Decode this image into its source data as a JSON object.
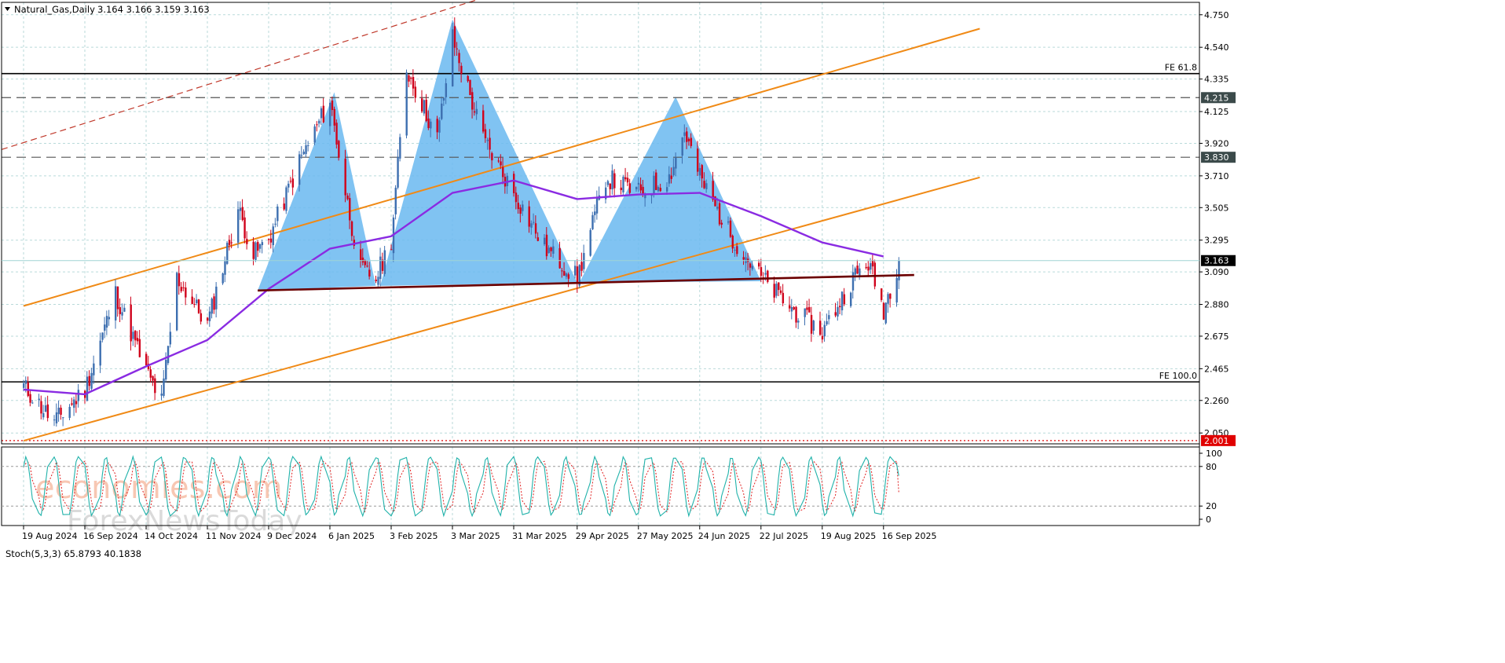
{
  "header": {
    "symbol": "Natural_Gas,Daily",
    "ohlc": "3.164 3.166 3.159 3.163"
  },
  "stoch": {
    "label": "Stoch(5,3,3) 65.8793 40.1838",
    "levels": [
      100,
      80,
      20,
      0
    ]
  },
  "watermark": {
    "line1": "economies.com",
    "line2": "ForexNewsToday"
  },
  "colors": {
    "bull_candle": "#3d6fb0",
    "bear_candle": "#d0021b",
    "pattern_fill": "#6ab8f0",
    "channel": "#f08a16",
    "moving_average": "#8a2be2",
    "neckline": "#6b0000",
    "dashed_top": "#c0392b",
    "stoch_main": "#20b2aa",
    "stoch_signal": "#e02020",
    "grid": "#b9dada"
  },
  "chart_data": {
    "type": "candlestick",
    "instrument": "Natural_Gas",
    "timeframe": "Daily",
    "last_price": 3.163,
    "ylim": [
      1.98,
      4.83
    ],
    "y_ticks": [
      "4.750",
      "4.540",
      "4.335",
      "4.125",
      "3.920",
      "3.710",
      "3.505",
      "3.295",
      "3.090",
      "2.880",
      "2.675",
      "2.465",
      "2.260",
      "2.050"
    ],
    "x_ticks": [
      "19 Aug 2024",
      "16 Sep 2024",
      "14 Oct 2024",
      "11 Nov 2024",
      "9 Dec 2024",
      "6 Jan 2025",
      "3 Feb 2025",
      "3 Mar 2025",
      "31 Mar 2025",
      "29 Apr 2025",
      "27 May 2025",
      "24 Jun 2025",
      "22 Jul 2025",
      "19 Aug 2025",
      "16 Sep 2025"
    ],
    "horizontal_levels": [
      {
        "label": "FE 61.8",
        "value": 4.37,
        "style": "solid"
      },
      {
        "label": "4.215",
        "value": 4.215,
        "style": "dashed"
      },
      {
        "label": "3.830",
        "value": 3.83,
        "style": "dashed"
      },
      {
        "label": "FE 100.0",
        "value": 2.38,
        "style": "solid"
      },
      {
        "label": "2.001",
        "value": 2.001,
        "style": "dotted"
      }
    ],
    "price_label": "3.163",
    "price_path": [
      [
        "19 Aug 2024",
        2.35
      ],
      [
        "2 Sep 2024",
        2.12
      ],
      [
        "16 Sep 2024",
        2.33
      ],
      [
        "30 Sep 2024",
        2.95
      ],
      [
        "14 Oct 2024",
        2.45
      ],
      [
        "21 Oct 2024",
        2.25
      ],
      [
        "28 Oct 2024",
        3.05
      ],
      [
        "11 Nov 2024",
        2.75
      ],
      [
        "25 Nov 2024",
        3.5
      ],
      [
        "2 Dec 2024",
        3.2
      ],
      [
        "9 Dec 2024",
        3.3
      ],
      [
        "23 Dec 2024",
        3.8
      ],
      [
        "6 Jan 2025",
        4.2
      ],
      [
        "13 Jan 2025",
        3.6
      ],
      [
        "20 Jan 2025",
        3.1
      ],
      [
        "27 Jan 2025",
        3.05
      ],
      [
        "3 Feb 2025",
        3.3
      ],
      [
        "10 Feb 2025",
        4.4
      ],
      [
        "24 Feb 2025",
        3.95
      ],
      [
        "3 Mar 2025",
        4.6
      ],
      [
        "17 Mar 2025",
        3.95
      ],
      [
        "31 Mar 2025",
        3.6
      ],
      [
        "14 Apr 2025",
        3.25
      ],
      [
        "29 Apr 2025",
        3.05
      ],
      [
        "12 May 2025",
        3.7
      ],
      [
        "27 May 2025",
        3.6
      ],
      [
        "10 Jun 2025",
        3.7
      ],
      [
        "17 Jun 2025",
        4.0
      ],
      [
        "24 Jun 2025",
        3.7
      ],
      [
        "7 Jul 2025",
        3.35
      ],
      [
        "22 Jul 2025",
        3.05
      ],
      [
        "5 Aug 2025",
        2.85
      ],
      [
        "19 Aug 2025",
        2.7
      ],
      [
        "2 Sep 2025",
        3.05
      ],
      [
        "9 Sep 2025",
        3.15
      ],
      [
        "16 Sep 2025",
        2.85
      ],
      [
        "23 Sep 2025",
        3.163
      ]
    ],
    "moving_average": [
      [
        "19 Aug 2024",
        2.33
      ],
      [
        "16 Sep 2024",
        2.3
      ],
      [
        "14 Oct 2024",
        2.48
      ],
      [
        "11 Nov 2024",
        2.65
      ],
      [
        "9 Dec 2024",
        2.98
      ],
      [
        "6 Jan 2025",
        3.24
      ],
      [
        "3 Feb 2025",
        3.32
      ],
      [
        "3 Mar 2025",
        3.6
      ],
      [
        "31 Mar 2025",
        3.68
      ],
      [
        "29 Apr 2025",
        3.56
      ],
      [
        "27 May 2025",
        3.59
      ],
      [
        "24 Jun 2025",
        3.6
      ],
      [
        "22 Jul 2025",
        3.45
      ],
      [
        "19 Aug 2025",
        3.28
      ],
      [
        "16 Sep 2025",
        3.19
      ]
    ],
    "neckline": [
      [
        "4 Dec 2024",
        2.97
      ],
      [
        "30 Sep 2025",
        3.07
      ]
    ],
    "channel_lines": [
      [
        [
          "19 Aug 2024",
          2.87
        ],
        [
          "30 Oct 2025",
          4.66
        ]
      ],
      [
        [
          "19 Aug 2024",
          2.0
        ],
        [
          "30 Oct 2025",
          3.7
        ]
      ]
    ],
    "pattern": "head and shoulders",
    "stochastic": {
      "k": 65.8793,
      "d": 40.1838
    }
  }
}
